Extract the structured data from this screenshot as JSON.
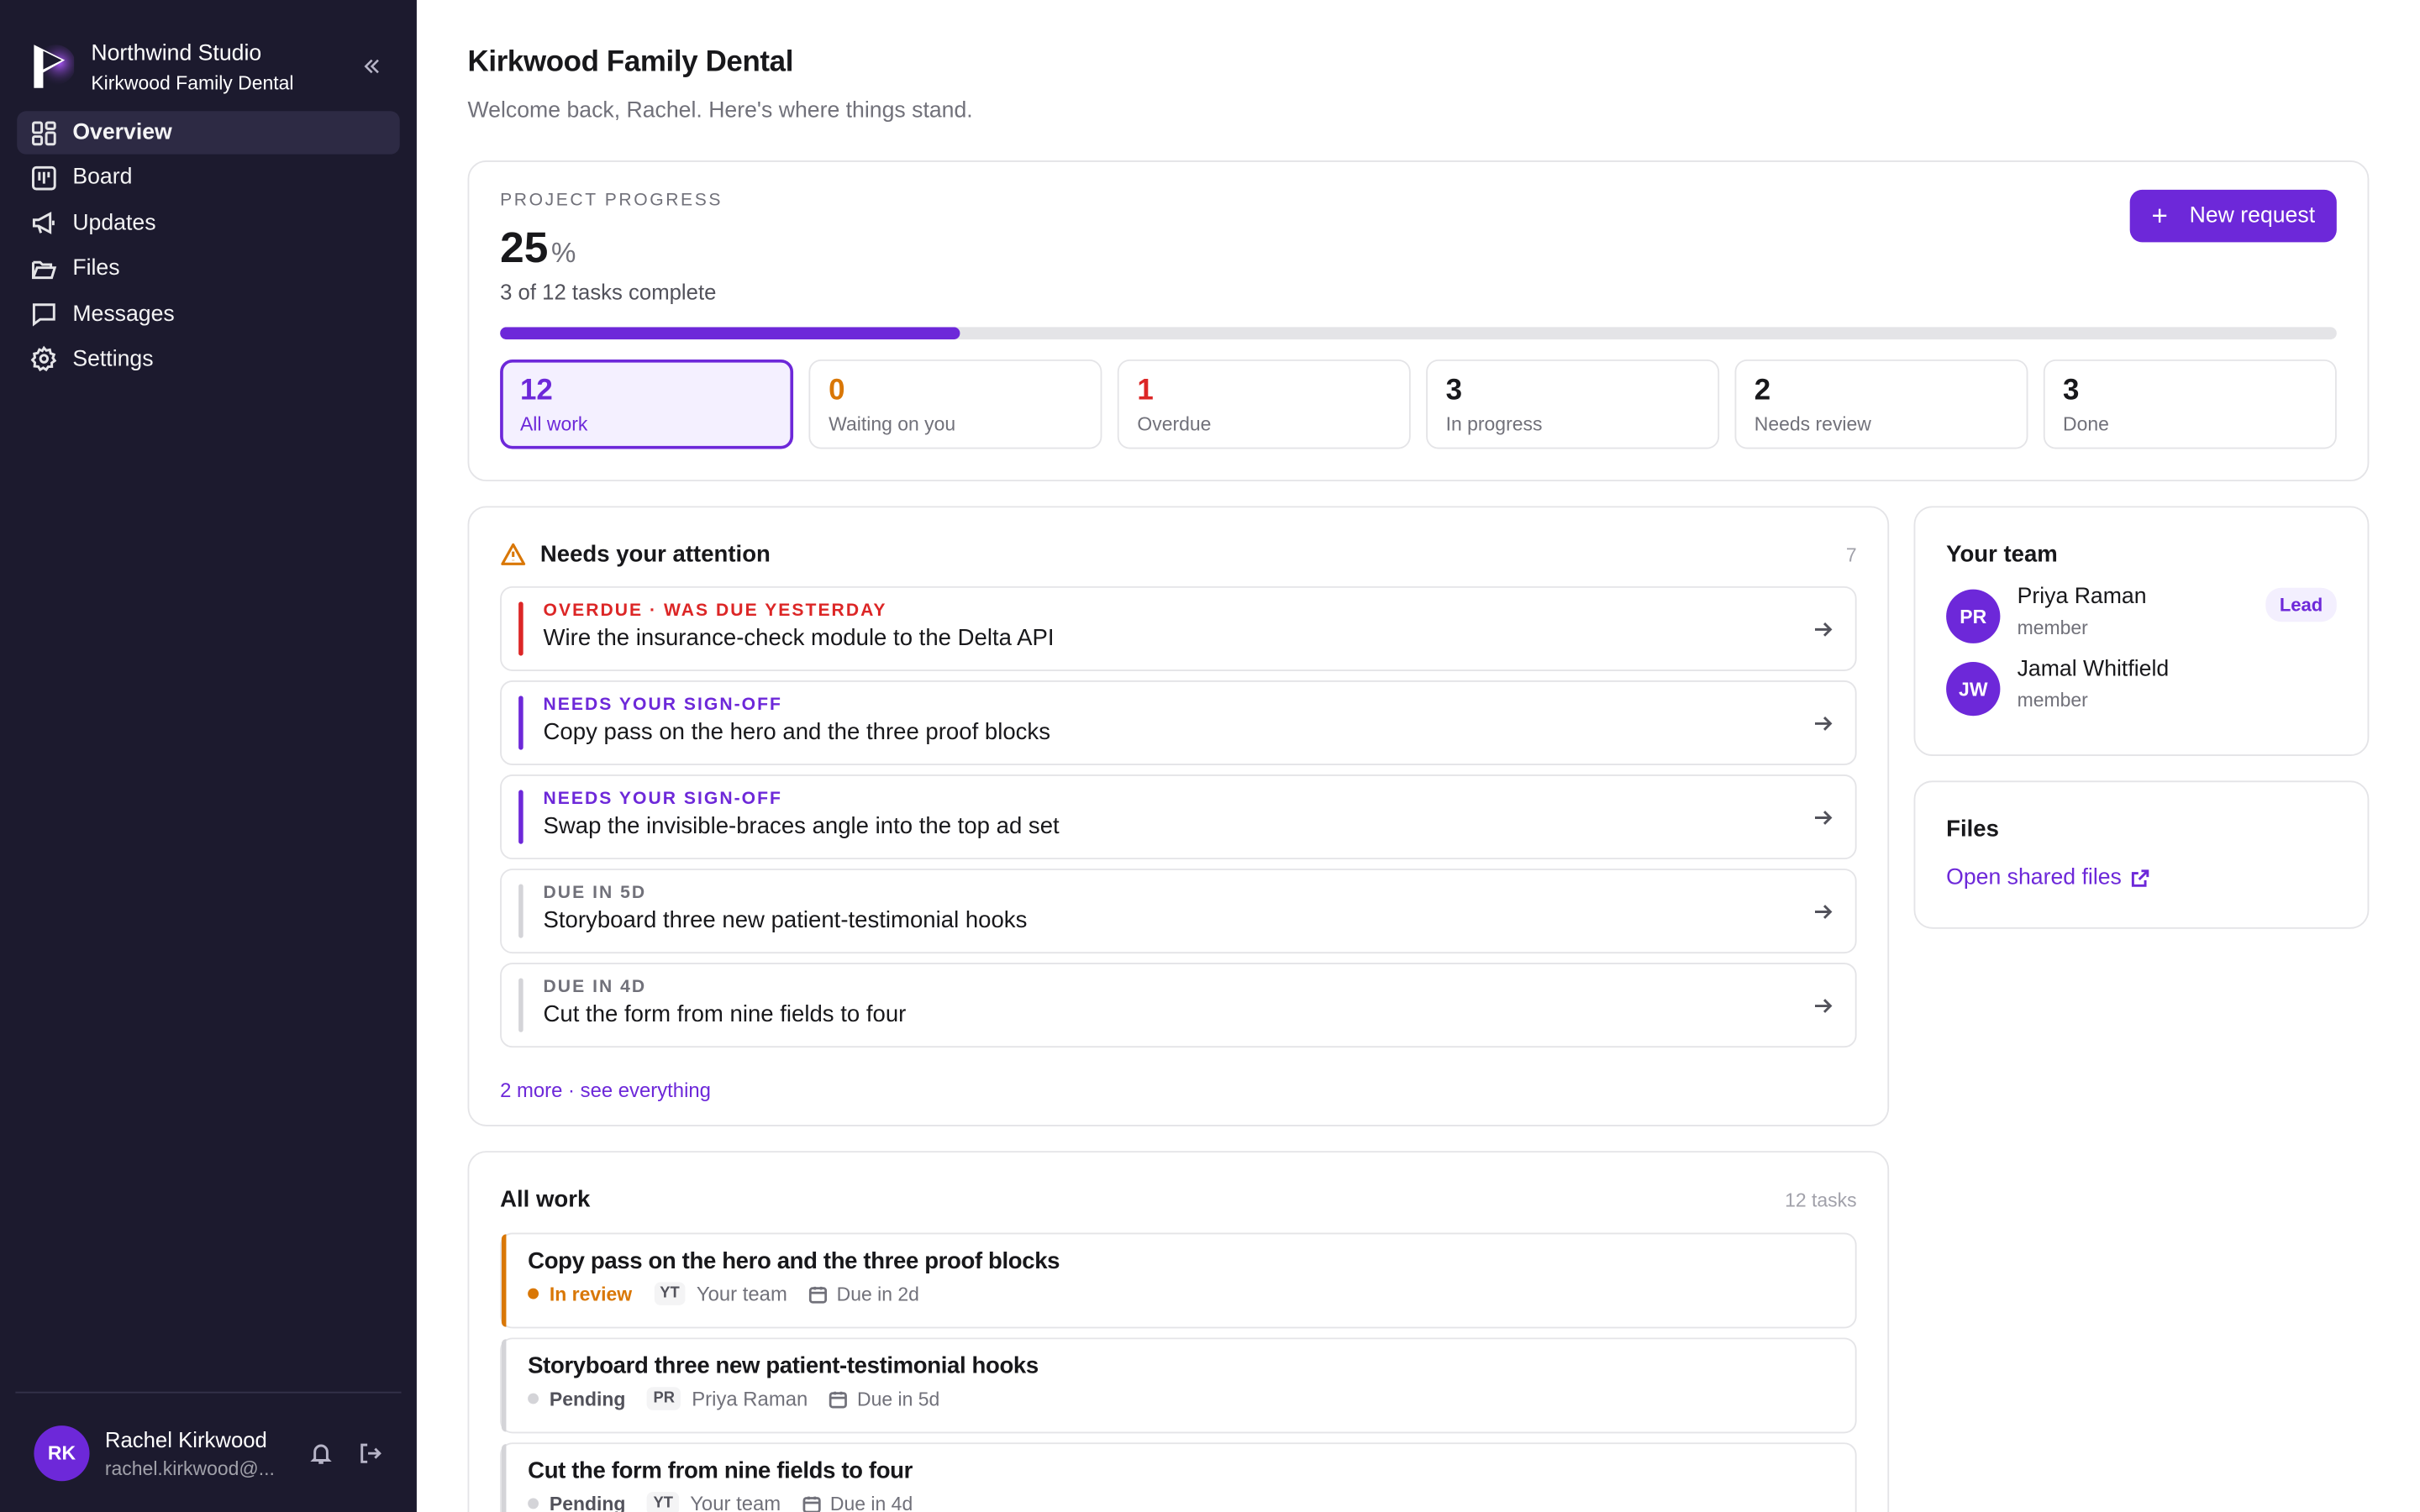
{
  "brand": {
    "name": "Northwind Studio",
    "client": "Kirkwood Family Dental"
  },
  "nav": [
    {
      "label": "Overview",
      "icon": "grid-icon",
      "active": true
    },
    {
      "label": "Board",
      "icon": "board-icon"
    },
    {
      "label": "Updates",
      "icon": "megaphone-icon"
    },
    {
      "label": "Files",
      "icon": "folder-icon"
    },
    {
      "label": "Messages",
      "icon": "message-icon"
    },
    {
      "label": "Settings",
      "icon": "gear-icon"
    }
  ],
  "user": {
    "initials": "RK",
    "name": "Rachel Kirkwood",
    "email": "rachel.kirkwood@..."
  },
  "header": {
    "title": "Kirkwood Family Dental",
    "subtitle": "Welcome back, Rachel. Here's where things stand."
  },
  "progress": {
    "eyebrow": "PROJECT PROGRESS",
    "value": "25",
    "unit": "%",
    "fraction": 0.25,
    "summary": "3 of 12 tasks complete",
    "new_request": "New request"
  },
  "stats": [
    {
      "num": "12",
      "label": "All work",
      "color": "#6d28d9"
    },
    {
      "num": "0",
      "label": "Waiting on you",
      "color": "#d97706"
    },
    {
      "num": "1",
      "label": "Overdue",
      "color": "#dc2626"
    },
    {
      "num": "3",
      "label": "In progress",
      "color": "#18181b"
    },
    {
      "num": "2",
      "label": "Needs review",
      "color": "#18181b"
    },
    {
      "num": "3",
      "label": "Done",
      "color": "#18181b"
    }
  ],
  "attention": {
    "title": "Needs your attention",
    "count": "7",
    "items": [
      {
        "tag": "OVERDUE · WAS DUE YESTERDAY",
        "text": "Wire the insurance-check module to the Delta API",
        "color": "#dc2626",
        "tag_color": "#dc2626"
      },
      {
        "tag": "NEEDS YOUR SIGN-OFF",
        "text": "Copy pass on the hero and the three proof blocks",
        "color": "#6d28d9",
        "tag_color": "#6d28d9"
      },
      {
        "tag": "NEEDS YOUR SIGN-OFF",
        "text": "Swap the invisible-braces angle into the top ad set",
        "color": "#6d28d9",
        "tag_color": "#6d28d9"
      },
      {
        "tag": "DUE IN 5D",
        "text": "Storyboard three new patient-testimonial hooks",
        "color": "#d4d4d8",
        "tag_color": "#71717a"
      },
      {
        "tag": "DUE IN 4D",
        "text": "Cut the form from nine fields to four",
        "color": "#d4d4d8",
        "tag_color": "#71717a"
      }
    ],
    "more": "2 more · see everything"
  },
  "work": {
    "title": "All work",
    "count": "12 tasks",
    "items": [
      {
        "title": "Copy pass on the hero and the three proof blocks",
        "status": "In review",
        "status_color": "#d97706",
        "stripe": "#d97706",
        "who_initials": "YT",
        "who": "Your team",
        "due": "Due in 2d"
      },
      {
        "title": "Storyboard three new patient-testimonial hooks",
        "status": "Pending",
        "status_color": "#52525b",
        "dot": "#d4d4d8",
        "stripe": "#d4d4d8",
        "who_initials": "PR",
        "who": "Priya Raman",
        "due": "Due in 5d"
      },
      {
        "title": "Cut the form from nine fields to four",
        "status": "Pending",
        "status_color": "#52525b",
        "dot": "#d4d4d8",
        "stripe": "#d4d4d8",
        "who_initials": "YT",
        "who": "Your team",
        "due": "Due in 4d"
      }
    ]
  },
  "team": {
    "title": "Your team",
    "members": [
      {
        "initials": "PR",
        "name": "Priya Raman",
        "role": "member",
        "badge": "Lead"
      },
      {
        "initials": "JW",
        "name": "Jamal Whitfield",
        "role": "member",
        "badge": ""
      }
    ]
  },
  "files": {
    "title": "Files",
    "link": "Open shared files"
  }
}
